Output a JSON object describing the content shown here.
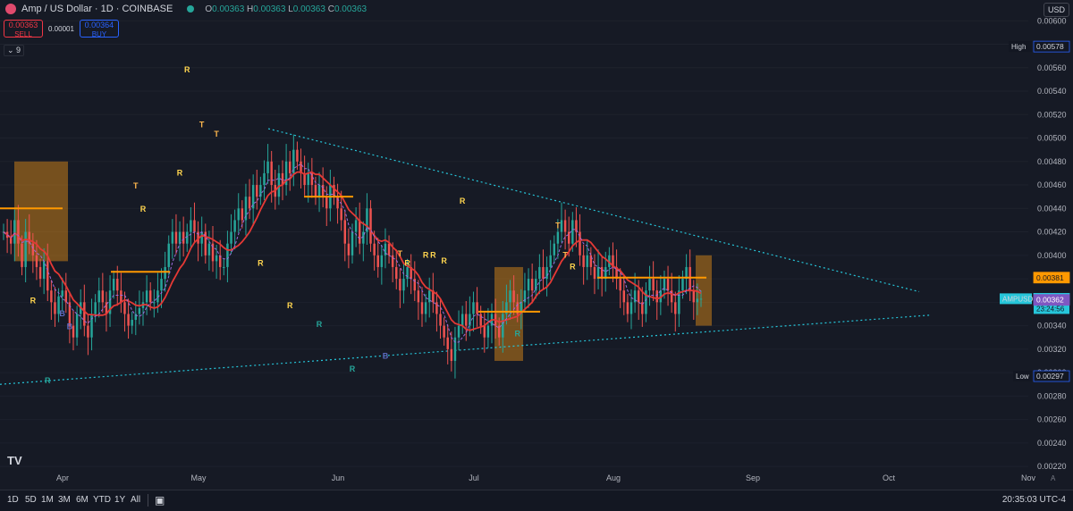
{
  "header": {
    "title": "Amp / US Dollar · 1D · COINBASE",
    "ohlc": {
      "o_label": "O",
      "o": "0.00363",
      "h_label": "H",
      "h": "0.00363",
      "l_label": "L",
      "l": "0.00363",
      "c_label": "C",
      "c": "0.00363"
    }
  },
  "trade": {
    "sell_price": "0.00363",
    "sell_label": "SELL",
    "spread": "0.00001",
    "buy_price": "0.00364",
    "buy_label": "BUY"
  },
  "indicator_toggle": "⌄ 9",
  "currency_button": "USD",
  "bottom_bar": {
    "timeframes": [
      "1D",
      "5D",
      "1M",
      "3M",
      "6M",
      "YTD",
      "1Y",
      "All"
    ],
    "clock": "20:35:03 UTC-4",
    "auto_label": "A"
  },
  "colors": {
    "up": "#26a69a",
    "down": "#ef5350",
    "background": "#161a25",
    "trendline": "#26c6da",
    "ma_red": "#e53935",
    "ma_green": "#43a047",
    "ma_dashed": "#9c6ade",
    "band": "#c77d1a",
    "level": "#ff9800",
    "label_R": "#ffd54f",
    "label_T": "#ffb74d",
    "label_B": "#5c6bc0"
  },
  "chart_data": {
    "type": "candlestick",
    "x_axis_labels": [
      "Apr",
      "May",
      "Jun",
      "Jul",
      "Aug",
      "Sep",
      "Oct",
      "Nov"
    ],
    "y_axis_ticks": [
      "0.00600",
      "0.00580",
      "0.00560",
      "0.00540",
      "0.00520",
      "0.00500",
      "0.00480",
      "0.00460",
      "0.00440",
      "0.00420",
      "0.00400",
      "0.00380",
      "0.00360",
      "0.00340",
      "0.00320",
      "0.00300",
      "0.00280",
      "0.00260",
      "0.00240",
      "0.00220"
    ],
    "ylim": [
      0.00214,
      0.00604
    ],
    "price_tags": [
      {
        "label": "High",
        "value": "0.00578"
      },
      {
        "label": "",
        "value": "0.00381"
      },
      {
        "label": "AMPUSD",
        "value": "0.00363",
        "sub": "23:24:56"
      },
      {
        "label": "",
        "value": "0.00362"
      },
      {
        "label": "Low",
        "value": "0.00297"
      }
    ],
    "closes": [
      0.0042,
      0.00415,
      0.0041,
      0.0043,
      0.0041,
      0.0039,
      0.0042,
      0.0041,
      0.004,
      0.0039,
      0.0038,
      0.00395,
      0.0037,
      0.0036,
      0.0035,
      0.00365,
      0.0037,
      0.0036,
      0.0034,
      0.0033,
      0.0035,
      0.0036,
      0.0034,
      0.0033,
      0.0035,
      0.0036,
      0.0037,
      0.0036,
      0.0035,
      0.0037,
      0.0038,
      0.0037,
      0.0036,
      0.0035,
      0.0034,
      0.00345,
      0.0035,
      0.00355,
      0.0036,
      0.0037,
      0.0036,
      0.0036,
      0.0037,
      0.0038,
      0.0039,
      0.0041,
      0.0042,
      0.0041,
      0.0042,
      0.0041,
      0.0042,
      0.0043,
      0.0042,
      0.0041,
      0.0042,
      0.004,
      0.0041,
      0.00395,
      0.004,
      0.0039,
      0.0039,
      0.0041,
      0.0042,
      0.0043,
      0.0044,
      0.0043,
      0.0045,
      0.0044,
      0.0046,
      0.0045,
      0.0046,
      0.0047,
      0.0048,
      0.0046,
      0.0045,
      0.0047,
      0.0046,
      0.0048,
      0.0047,
      0.0049,
      0.0048,
      0.0047,
      0.0046,
      0.0047,
      0.0046,
      0.0045,
      0.0046,
      0.0045,
      0.0044,
      0.0046,
      0.0045,
      0.0044,
      0.0043,
      0.0041,
      0.004,
      0.0042,
      0.0043,
      0.0041,
      0.0042,
      0.0044,
      0.0041,
      0.004,
      0.0039,
      0.004,
      0.0041,
      0.004,
      0.0039,
      0.0038,
      0.0037,
      0.0038,
      0.0039,
      0.0038,
      0.0037,
      0.0036,
      0.0035,
      0.0036,
      0.0037,
      0.0036,
      0.0035,
      0.0034,
      0.0033,
      0.0032,
      0.0031,
      0.0033,
      0.0034,
      0.0035,
      0.0034,
      0.0035,
      0.0036,
      0.0035,
      0.0034,
      0.0033,
      0.0034,
      0.0035,
      0.0034,
      0.0033,
      0.0035,
      0.0036,
      0.0037,
      0.0036,
      0.0035,
      0.0036,
      0.0037,
      0.0038,
      0.0037,
      0.0038,
      0.0039,
      0.0038,
      0.0039,
      0.004,
      0.0041,
      0.0042,
      0.0043,
      0.0042,
      0.0041,
      0.0043,
      0.0042,
      0.004,
      0.0039,
      0.004,
      0.0039,
      0.0038,
      0.0039,
      0.0038,
      0.0039,
      0.004,
      0.0039,
      0.0038,
      0.0037,
      0.0036,
      0.0035,
      0.0036,
      0.0037,
      0.0036,
      0.0035,
      0.0037,
      0.0038,
      0.0037,
      0.0036,
      0.0037,
      0.0038,
      0.0037,
      0.0036,
      0.0035,
      0.0037,
      0.0038,
      0.0039,
      0.0037,
      0.0036,
      0.00363,
      0.00363
    ],
    "red_ma_label": "red MA",
    "labels": [
      {
        "text": "R",
        "i": 8,
        "y": 0.00359
      },
      {
        "text": "B",
        "i": 16,
        "y": 0.00348
      },
      {
        "text": "B",
        "i": 18,
        "y": 0.00337
      },
      {
        "text": "R",
        "i": 12,
        "y": 0.00291
      },
      {
        "text": "T",
        "i": 36,
        "y": 0.00457
      },
      {
        "text": "R",
        "i": 38,
        "y": 0.00437
      },
      {
        "text": "R",
        "i": 48,
        "y": 0.00468
      },
      {
        "text": "R",
        "i": 50,
        "y": 0.00556
      },
      {
        "text": "T",
        "i": 54,
        "y": 0.00509
      },
      {
        "text": "T",
        "i": 58,
        "y": 0.00501
      },
      {
        "text": "R",
        "i": 70,
        "y": 0.00391
      },
      {
        "text": "R",
        "i": 78,
        "y": 0.00355
      },
      {
        "text": "R",
        "i": 86,
        "y": 0.00339
      },
      {
        "text": "R",
        "i": 95,
        "y": 0.00301
      },
      {
        "text": "B",
        "i": 104,
        "y": 0.00312
      },
      {
        "text": "T",
        "i": 108,
        "y": 0.00399
      },
      {
        "text": "R",
        "i": 110,
        "y": 0.00391
      },
      {
        "text": "R",
        "i": 115,
        "y": 0.00398
      },
      {
        "text": "R",
        "i": 117,
        "y": 0.00398
      },
      {
        "text": "R",
        "i": 120,
        "y": 0.00393
      },
      {
        "text": "R",
        "i": 125,
        "y": 0.00444
      },
      {
        "text": "R",
        "i": 140,
        "y": 0.00331
      },
      {
        "text": "T",
        "i": 151,
        "y": 0.00423
      },
      {
        "text": "T",
        "i": 153,
        "y": 0.00398
      },
      {
        "text": "R",
        "i": 155,
        "y": 0.00388
      }
    ]
  }
}
